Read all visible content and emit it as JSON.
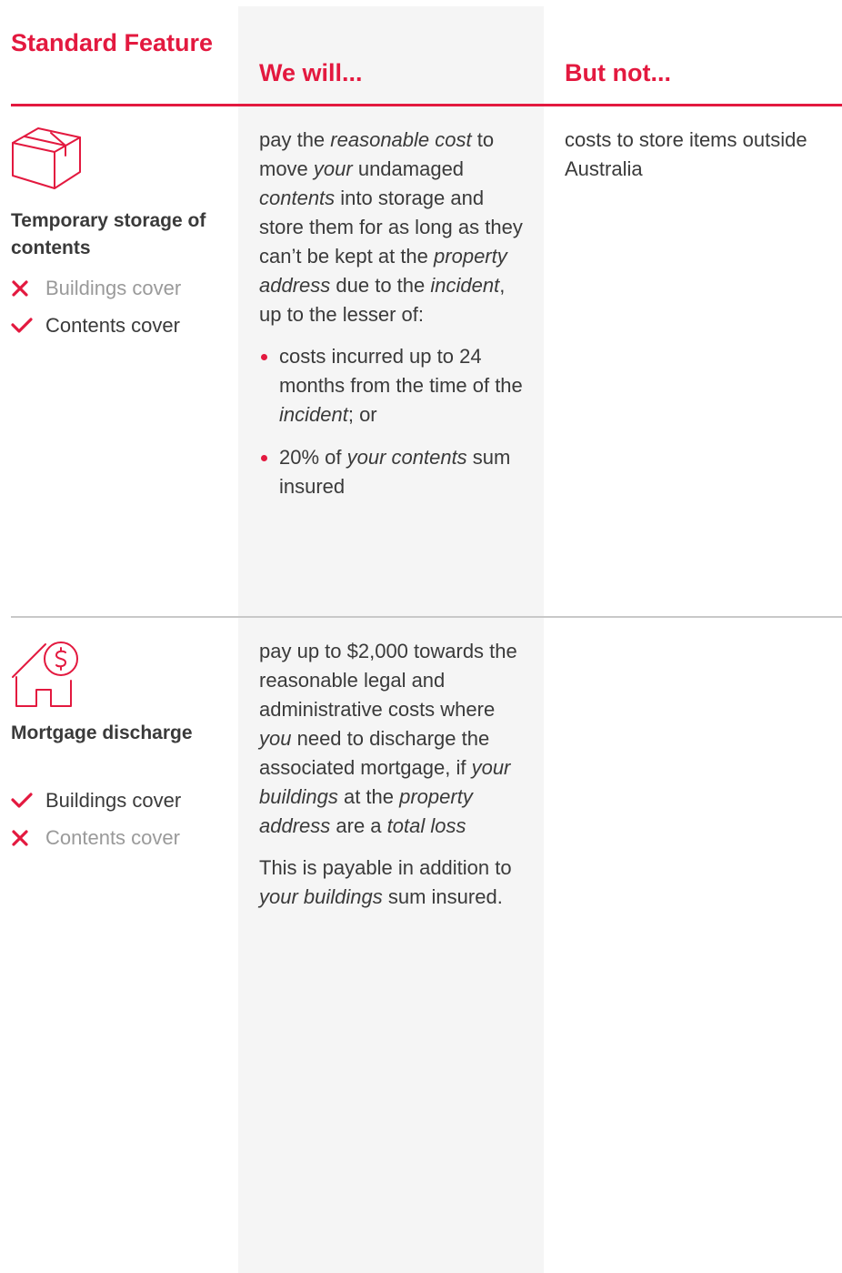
{
  "headers": {
    "feature": "Standard Feature",
    "we_will": "We will...",
    "but_not": "But not..."
  },
  "colors": {
    "accent": "#e3193f",
    "shade": "#f5f5f5",
    "text": "#3a3a3a",
    "muted": "#9a9a9a"
  },
  "rows": [
    {
      "icon": "box-icon",
      "title": "Temporary storage of contents",
      "covers": [
        {
          "label": "Buildings cover",
          "included": false
        },
        {
          "label": "Contents cover",
          "included": true
        }
      ],
      "we_will": {
        "p1": [
          "pay the ",
          "reasonable cost",
          " to move ",
          "your",
          " undamaged ",
          "contents",
          " into storage and store them for as long as they can’t be kept at the ",
          "property address",
          " due to the ",
          "incident",
          ", up to the lesser of:"
        ],
        "bullets": [
          [
            "costs incurred up to 24 months from the time of the ",
            "incident",
            "; or"
          ],
          [
            "20% of ",
            "your contents",
            " sum insured"
          ]
        ]
      },
      "but_not": "costs to store items outside Australia"
    },
    {
      "icon": "house-dollar-icon",
      "title": "Mortgage discharge",
      "covers": [
        {
          "label": "Buildings cover",
          "included": true
        },
        {
          "label": "Contents cover",
          "included": false
        }
      ],
      "we_will": {
        "p1": [
          "pay up to $2,000 towards the reasonable legal and administrative costs where ",
          "you",
          " need to discharge the associated mortgage, if ",
          "your buildings",
          " at the ",
          "property address",
          " are a ",
          "total loss"
        ],
        "p2": [
          "This is payable in addition to ",
          "your buildings",
          " sum insured."
        ]
      },
      "but_not": ""
    }
  ]
}
